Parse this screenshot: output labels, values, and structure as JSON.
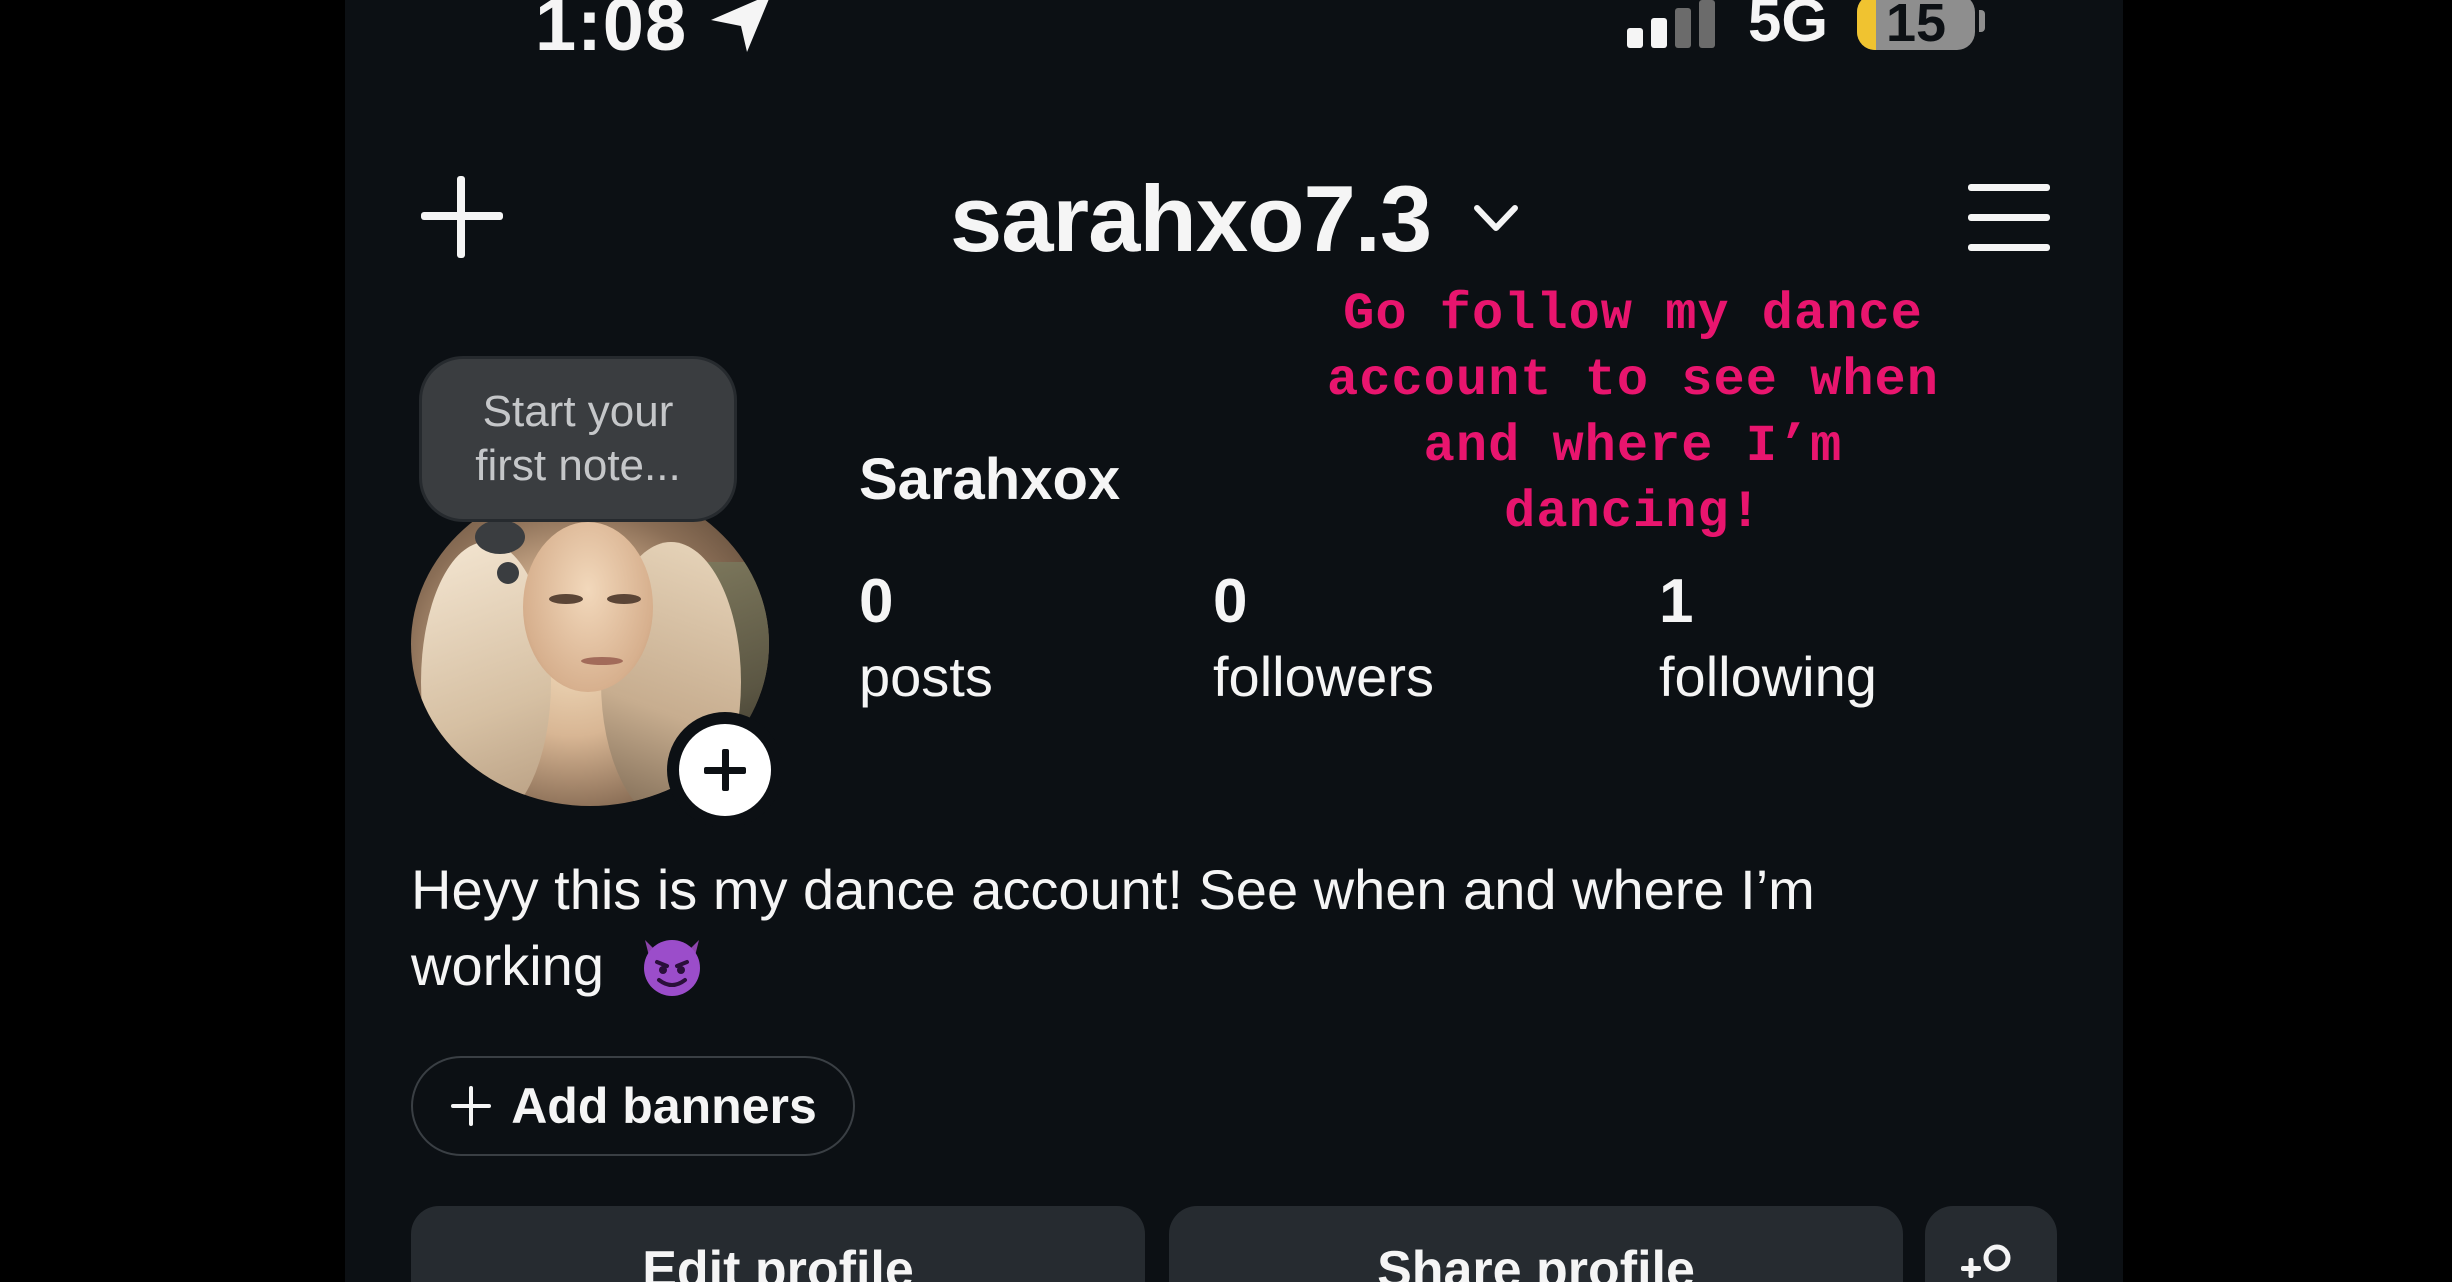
{
  "status_bar": {
    "time": "1:08",
    "network": "5G",
    "battery": "15"
  },
  "header": {
    "username": "sarahxo7.3"
  },
  "overlay": {
    "text": "Go follow my dance\naccount to see when\nand where I’m\ndancing!",
    "color": "#e8156e"
  },
  "note": {
    "placeholder": "Start your first note..."
  },
  "profile": {
    "display_name": "Sarahxox",
    "stats": [
      {
        "value": "0",
        "label": "posts"
      },
      {
        "value": "0",
        "label": "followers"
      },
      {
        "value": "1",
        "label": "following"
      }
    ],
    "bio": "Heyy this is my dance account! See when and where I’m\nworking",
    "bio_emoji": "smiling-devil-icon"
  },
  "buttons": {
    "add_banners": "Add banners",
    "edit_profile": "Edit profile",
    "share_profile": "Share profile"
  },
  "colors": {
    "background": "#0c1014",
    "button_bg": "#262b30",
    "accent_overlay": "#e8156e",
    "battery_fill": "#f0c330"
  }
}
